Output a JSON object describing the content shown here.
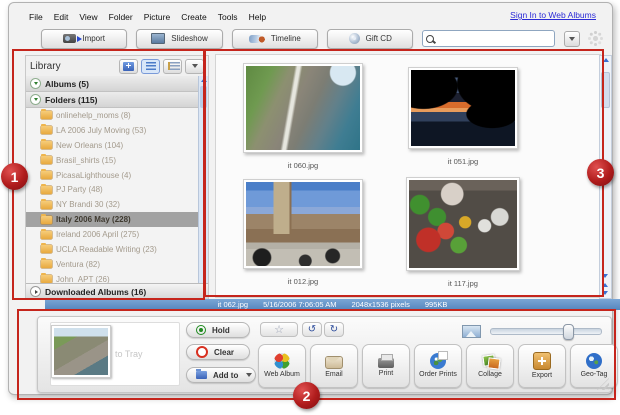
{
  "window": {
    "menu": [
      "File",
      "Edit",
      "View",
      "Folder",
      "Picture",
      "Create",
      "Tools",
      "Help"
    ],
    "sign_in": "Sign In to Web Albums"
  },
  "toolbar": {
    "buttons": [
      {
        "label": "Import",
        "icon": "camera-import-icon"
      },
      {
        "label": "Slideshow",
        "icon": "slideshow-icon"
      },
      {
        "label": "Timeline",
        "icon": "timeline-icon"
      },
      {
        "label": "Gift CD",
        "icon": "gift-cd-icon"
      }
    ],
    "search": {
      "value": "",
      "placeholder": ""
    }
  },
  "sidebar": {
    "title": "Library",
    "groups": [
      {
        "label": "Albums (5)"
      },
      {
        "label": "Folders (115)"
      }
    ],
    "folders": [
      {
        "label": "onlinehelp_moms (8)"
      },
      {
        "label": "LA 2006 July Moving (53)"
      },
      {
        "label": "New Orleans (104)"
      },
      {
        "label": "Brasil_shirts (15)"
      },
      {
        "label": "PicasaLighthouse (4)"
      },
      {
        "label": "PJ Party (48)"
      },
      {
        "label": "NY Brandi 30 (32)"
      },
      {
        "label": "Italy 2006 May (228)",
        "selected": true
      },
      {
        "label": "Ireland 2006 April (275)"
      },
      {
        "label": "UCLA Readable Writing (23)"
      },
      {
        "label": "Ventura (82)"
      },
      {
        "label": "John_APT (26)"
      }
    ],
    "bottom_item": "Downloaded Albums (16)"
  },
  "photo_grid": {
    "photos": [
      {
        "caption": "it 060.jpg"
      },
      {
        "caption": "it 051.jpg"
      },
      {
        "caption": "it 012.jpg"
      },
      {
        "caption": "it 117.jpg"
      }
    ]
  },
  "status_bar": {
    "filename": "it 062.jpg",
    "datetime": "5/16/2006 7:06:05 AM",
    "dimensions": "2048x1536 pixels",
    "filesize": "995KB"
  },
  "tray": {
    "hint": "to Tray",
    "hold": "Hold",
    "clear": "Clear",
    "add_to": "Add to",
    "actions": [
      "Web Album",
      "Email",
      "Print",
      "Order Prints",
      "Collage",
      "Export",
      "Geo-Tag"
    ],
    "zoom_slider_pct": 65
  },
  "icons": {
    "star": "☆",
    "rotate_ccw": "↺",
    "rotate_cw": "↻"
  },
  "annotations": {
    "region1": "1",
    "region2": "2",
    "region3": "3"
  },
  "colors": {
    "annotation_red": "#c5251c",
    "status_bar_blue": "#5585bd",
    "link_blue": "#2b2bd6",
    "selection_gray": "#a2a2a2",
    "folder_yellow": "#eeb34a"
  }
}
